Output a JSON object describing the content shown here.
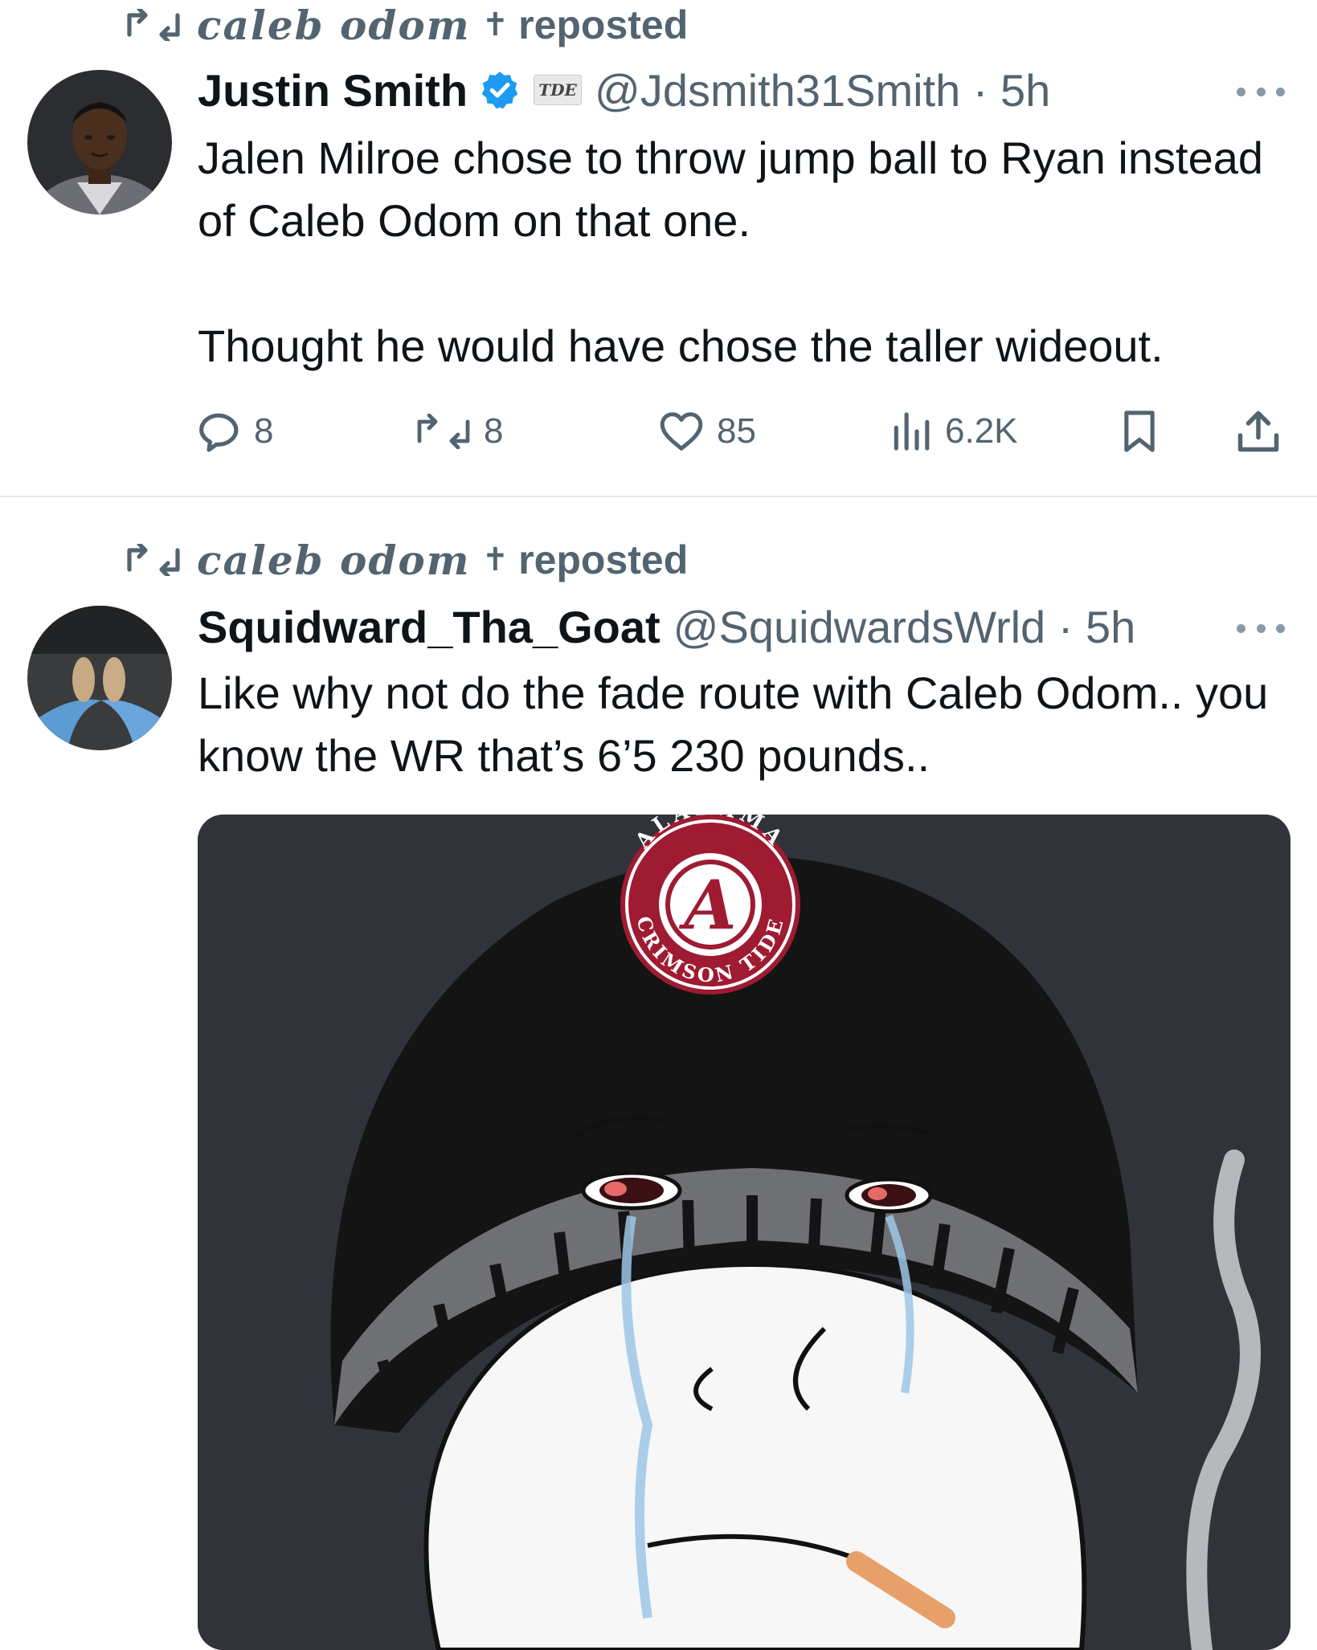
{
  "tweets": [
    {
      "reposted_by": "caleb odom",
      "reposted_label": "reposted",
      "author": {
        "name": "Justin Smith",
        "affiliate_badge": "TDE",
        "handle": "@Jdsmith31Smith",
        "time": "5h"
      },
      "paragraphs": [
        "Jalen Milroe chose to throw jump ball to Ryan instead of Caleb Odom on that one.",
        "Thought he would have chose the taller wideout."
      ],
      "stats": {
        "replies": "8",
        "reposts": "8",
        "likes": "85",
        "views": "6.2K"
      }
    },
    {
      "reposted_by": "caleb odom",
      "reposted_label": "reposted",
      "author": {
        "name": "Squidward_Tha_Goat",
        "handle": "@SquidwardsWrld",
        "time": "5h"
      },
      "paragraphs": [
        "Like why not do the fade route with Caleb Odom.. you know the WR that’s 6’5 230 pounds.."
      ],
      "media": {
        "logo_top": "ALABAMA",
        "logo_bottom": "CRIMSON TIDE",
        "logo_letter": "A"
      }
    }
  ],
  "colors": {
    "text": "#0f1419",
    "secondary": "#536471",
    "verified": "#1d9bf0",
    "crimson": "#9e1b32"
  },
  "icons": [
    "repost-icon",
    "verified-icon",
    "reply-icon",
    "like-icon",
    "views-icon",
    "bookmark-icon",
    "share-icon",
    "more-icon"
  ]
}
